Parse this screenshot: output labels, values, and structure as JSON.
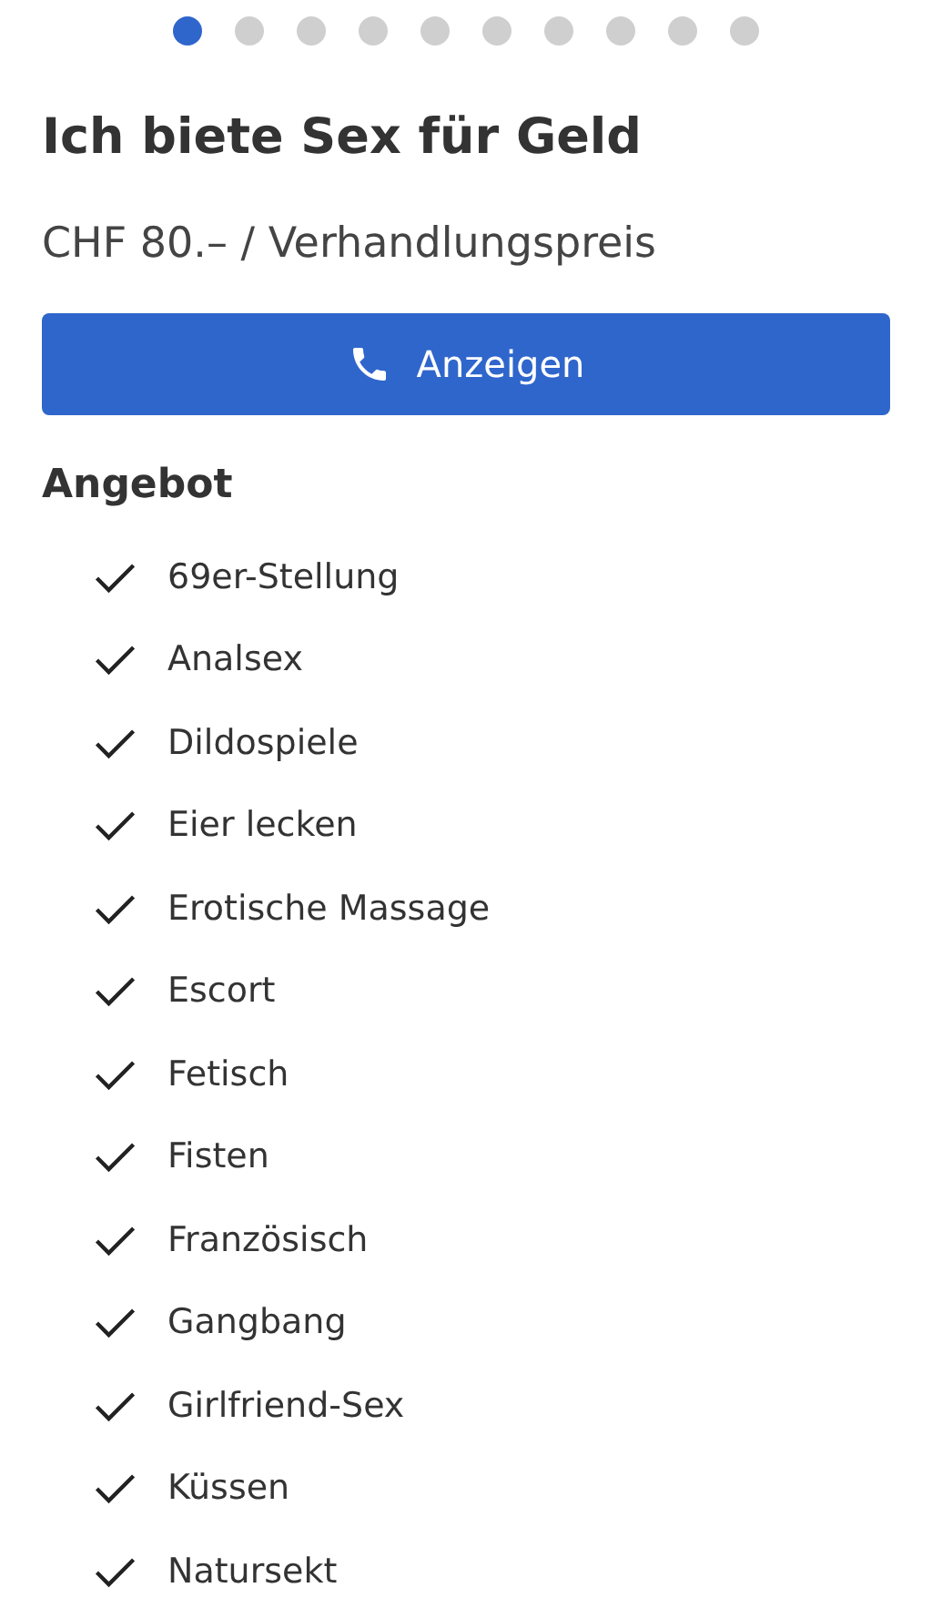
{
  "carousel_dots": [
    {
      "selected": true
    },
    {
      "selected": false
    },
    {
      "selected": false
    },
    {
      "selected": false
    },
    {
      "selected": false
    },
    {
      "selected": false
    },
    {
      "selected": false
    },
    {
      "selected": false
    },
    {
      "selected": false
    },
    {
      "selected": false
    }
  ],
  "title": "Ich biete Sex für Geld",
  "price": "CHF 80.– / Verhandlungspreis",
  "contact_button": {
    "label": "Anzeigen"
  },
  "offer": {
    "heading": "Angebot",
    "items": [
      {
        "label": "69er-Stellung",
        "checked": true
      },
      {
        "label": "Analsex",
        "checked": true
      },
      {
        "label": "Dildospiele",
        "checked": true
      },
      {
        "label": "Eier lecken",
        "checked": true
      },
      {
        "label": "Erotische Massage",
        "checked": true
      },
      {
        "label": "Escort",
        "checked": true
      },
      {
        "label": "Fetisch",
        "checked": true
      },
      {
        "label": "Fisten",
        "checked": true
      },
      {
        "label": "Französisch",
        "checked": true
      },
      {
        "label": "Gangbang",
        "checked": true
      },
      {
        "label": "Girlfriend-Sex",
        "checked": true
      },
      {
        "label": "Küssen",
        "checked": true
      },
      {
        "label": "Natursekt",
        "checked": true
      }
    ]
  }
}
